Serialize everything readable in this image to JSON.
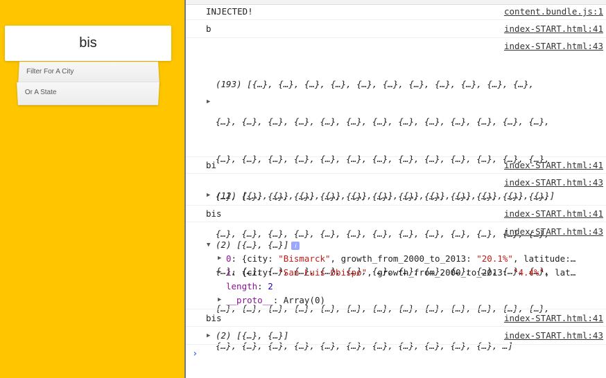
{
  "app": {
    "search_value": "bis",
    "suggestions": [
      "Filter For A City",
      "Or A State"
    ]
  },
  "console": {
    "messages": [
      {
        "text": "INJECTED!",
        "source": "content.bundle.js:1"
      },
      {
        "text": "b",
        "source": "index-START.html:41"
      },
      {
        "source": "index-START.html:43",
        "array_lines": [
          "(193) [{…}, {…}, {…}, {…}, {…}, {…}, {…}, {…}, {…}, {…}, {…},",
          "{…}, {…}, {…}, {…}, {…}, {…}, {…}, {…}, {…}, {…}, {…}, {…}, {…},",
          "{…}, {…}, {…}, {…}, {…}, {…}, {…}, {…}, {…}, {…}, {…}, {…}, {…},",
          "{…}, {…}, {…}, {…}, {…}, {…}, {…}, {…}, {…}, {…}, {…}, {…}, {…},",
          "{…}, {…}, {…}, {…}, {…}, {…}, {…}, {…}, {…}, {…}, {…}, {…}, {…},",
          "{…}, {…}, {…}, {…}, {…}, {…}, {…}, {…}, {…}, {…}, {…}, {…}, {…},",
          "{…}, {…}, {…}, {…}, {…}, {…}, {…}, {…}, {…}, {…}, {…}, {…}, {…},",
          "{…}, {…}, {…}, {…}, {…}, {…}, {…}, {…}, {…}, {…}, {…}, …]"
        ]
      },
      {
        "text": "bi",
        "source": "index-START.html:41"
      },
      {
        "source": "index-START.html:43",
        "text": "(12) [{…}, {…}, {…}, {…}, {…}, {…}, {…}, {…}, {…}, {…}, {…}, {…}]"
      },
      {
        "text": "bis",
        "source": "index-START.html:41"
      },
      {
        "source": "index-START.html:43",
        "text": "(2) [{…}, {…}]",
        "expanded": {
          "item0_key": "0",
          "item0_prefix": ": {city: ",
          "item0_city": "\"Bismarck\"",
          "item0_mid": ", growth_from_2000_to_2013: ",
          "item0_growth": "\"20.1%\"",
          "item0_tail": ", latitude:…",
          "item1_key": "1",
          "item1_prefix": ": {city: ",
          "item1_city": "\"San Luis Obispo\"",
          "item1_mid": ", growth_from_2000_to_2013: ",
          "item1_growth": "\"4.4%\"",
          "item1_tail": ", lat…",
          "length_key": "length",
          "length_val": "2",
          "proto_key": "__proto__",
          "proto_val": ": Array(0)"
        }
      },
      {
        "text": "bis",
        "source": "index-START.html:41"
      },
      {
        "source": "index-START.html:43",
        "text": "(2) [{…}, {…}]"
      }
    ],
    "prompt": "›",
    "info_glyph": "i",
    "arrow_collapsed": "▶",
    "arrow_expanded": "▼",
    "colors": {
      "app_bg": "#ffc600",
      "prompt": "#367cf1",
      "string": "#c41a16",
      "key": "#881391",
      "number": "#1c00cf"
    }
  }
}
